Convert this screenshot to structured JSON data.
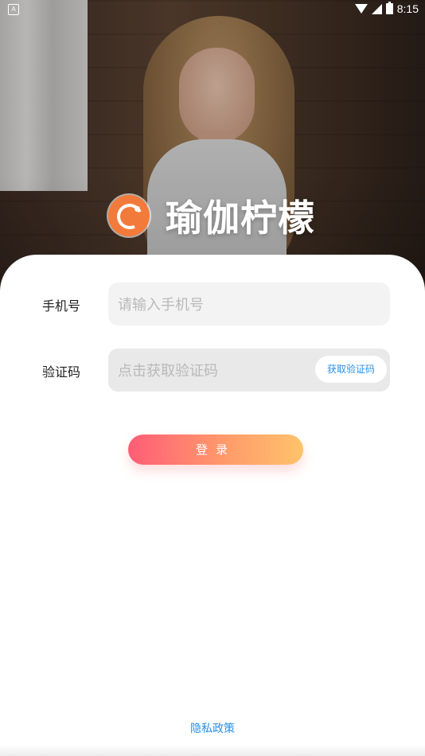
{
  "status_bar": {
    "left_indicator": "A",
    "time": "8:15",
    "icons": [
      "wifi-icon",
      "signal-icon",
      "battery-icon"
    ]
  },
  "brand": {
    "title": "瑜伽柠檬",
    "logo_icon": "lemon-logo-icon"
  },
  "form": {
    "phone_label": "手机号",
    "phone_placeholder": "请输入手机号",
    "code_label": "验证码",
    "code_placeholder": "点击获取验证码",
    "get_code_button": "获取验证码",
    "login_button": "登录"
  },
  "footer": {
    "privacy_link": "隐私政策"
  },
  "colors": {
    "accent_blue": "#2b8fe6",
    "login_gradient_start": "#ff5d76",
    "login_gradient_end": "#ffc36b",
    "brand_orange": "#f27b3b"
  }
}
